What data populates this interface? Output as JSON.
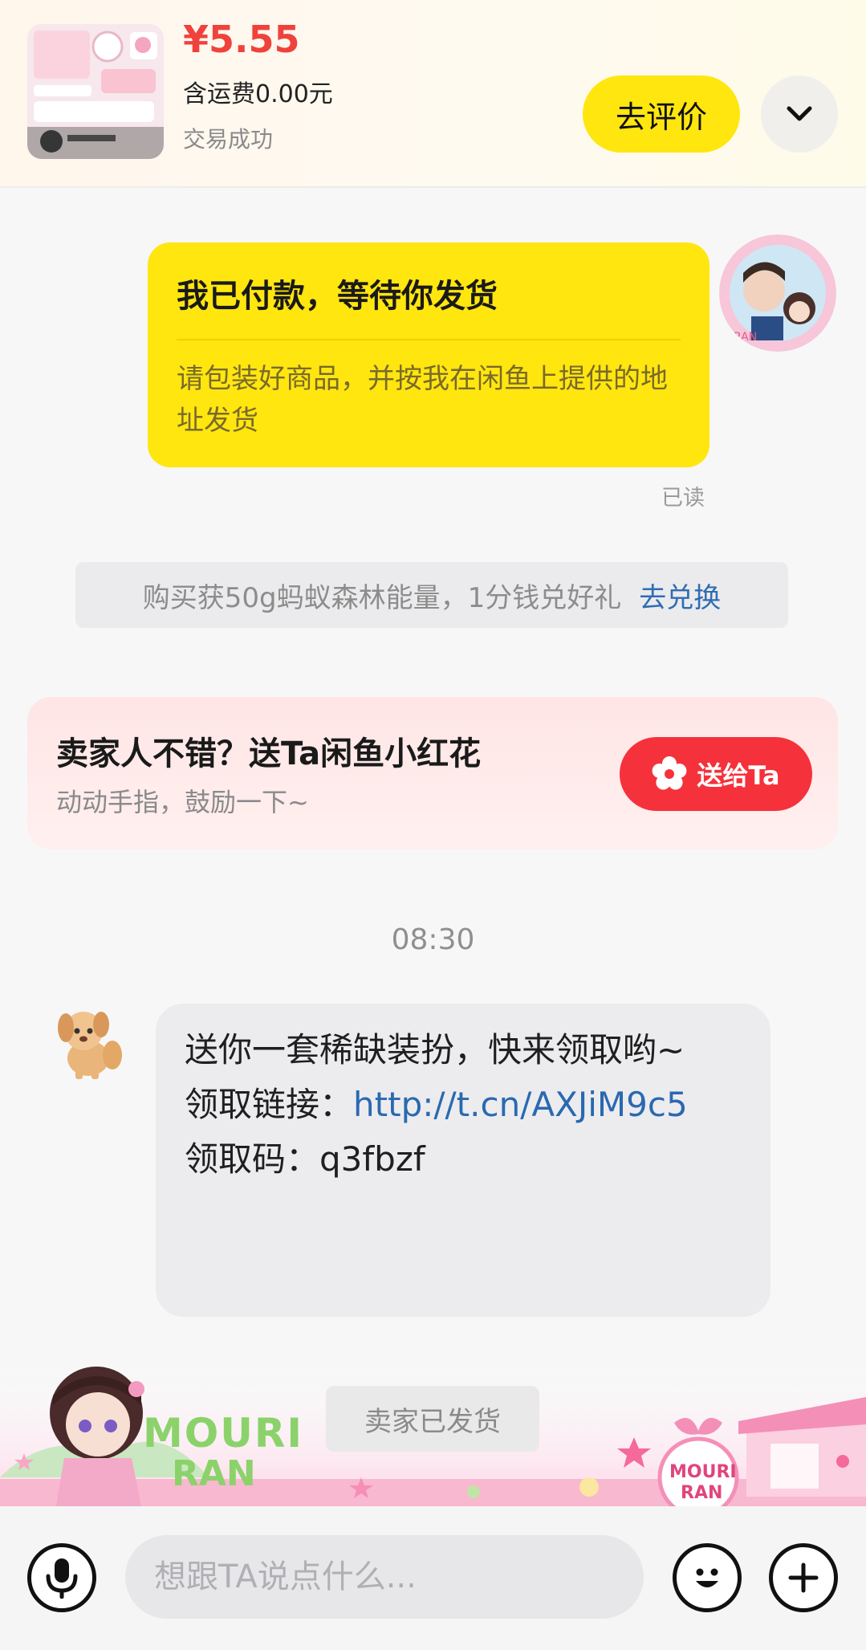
{
  "order": {
    "price": "¥5.55",
    "shipping": "含运费0.00元",
    "status": "交易成功",
    "review_button": "去评价"
  },
  "messages": {
    "sent": {
      "title": "我已付款，等待你发货",
      "body": "请包装好商品，并按我在闲鱼上提供的地址发货",
      "read_status": "已读"
    },
    "promo": {
      "text": "购买获50g蚂蚁森林能量，1分钱兑好礼",
      "link": "去兑换"
    },
    "flower_card": {
      "title": "卖家人不错？送Ta闲鱼小红花",
      "subtitle": "动动手指，鼓励一下~",
      "button": "送给Ta"
    },
    "time": "08:30",
    "received": {
      "line1": "送你一套稀缺装扮，快来领取哟~",
      "link_label": "领取链接：",
      "link_url": "http://t.cn/AXJiM9c5",
      "code_label": "领取码：",
      "code": "q3fbzf"
    },
    "system_status": "卖家已发货",
    "decoration_text": "MOURI RAN"
  },
  "input": {
    "placeholder": "想跟TA说点什么..."
  },
  "colors": {
    "accent_yellow": "#ffe60f",
    "price_red": "#f0423c",
    "send_red": "#f5313b",
    "link_blue": "#2a69b0"
  },
  "icons": [
    "chevron-down-icon",
    "flower-icon",
    "microphone-icon",
    "emoji-icon",
    "plus-icon"
  ]
}
